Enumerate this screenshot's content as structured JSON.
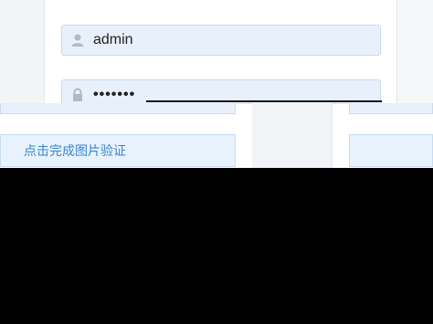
{
  "login": {
    "username_value": "admin",
    "password_value": "•••••••"
  },
  "captcha": {
    "label": "点击完成图片验证"
  },
  "icons": {
    "user": "user-icon",
    "lock": "lock-icon"
  },
  "colors": {
    "input_bg": "#e8f0fb",
    "link_blue": "#3a86cf"
  }
}
